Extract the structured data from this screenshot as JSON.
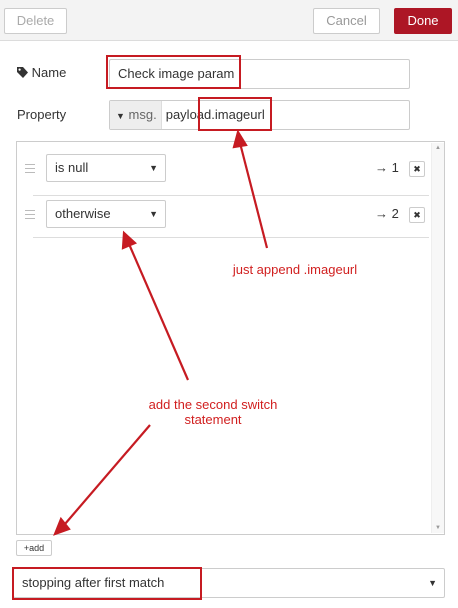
{
  "toolbar": {
    "delete_label": "Delete",
    "cancel_label": "Cancel",
    "done_label": "Done"
  },
  "form": {
    "name_label": "Name",
    "name_icon": "tag-icon",
    "name_value": "Check image param",
    "property_label": "Property",
    "property_prefix": "msg.",
    "property_value": "payload.imageurl"
  },
  "rules": [
    {
      "operator": "is null",
      "output": "→ 1"
    },
    {
      "operator": "otherwise",
      "output": "→ 2"
    }
  ],
  "add_button_label": "add",
  "mode_select": {
    "value": "stopping after first match"
  },
  "annotations": {
    "append": "just append .imageurl",
    "second_switch_line1": "add the second switch",
    "second_switch_line2": "statement"
  },
  "colors": {
    "accent": "#ad1625",
    "annotation": "#d11f1f"
  }
}
